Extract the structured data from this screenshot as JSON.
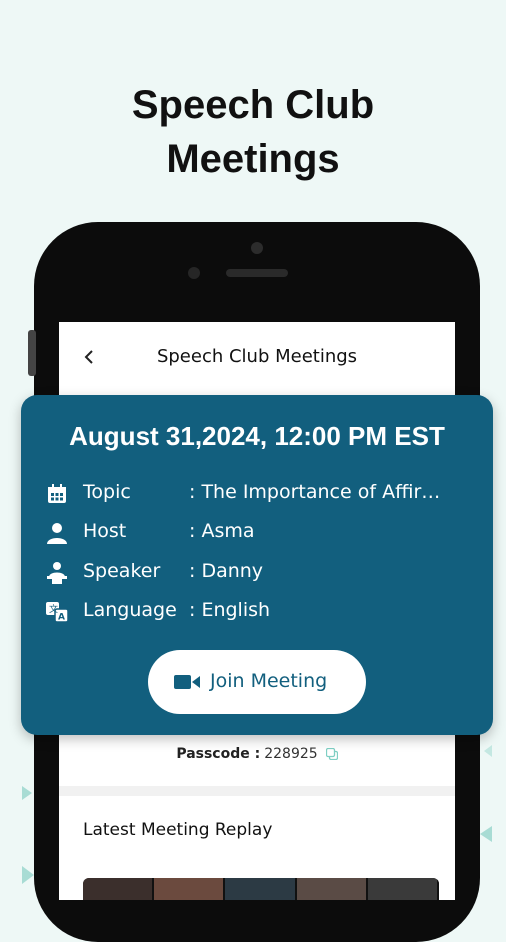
{
  "headline": {
    "line1": "Speech Club",
    "line2": "Meetings"
  },
  "app_bar": {
    "title": "Speech Club Meetings",
    "back_icon": "chevron-left-icon"
  },
  "meeting": {
    "datetime": "August 31,2024, 12:00 PM EST",
    "rows": [
      {
        "label": "Topic",
        "value": ": The Importance of Affir…",
        "icon": "calendar-icon"
      },
      {
        "label": "Host",
        "value": ": Asma",
        "icon": "person-icon"
      },
      {
        "label": "Speaker",
        "value": ": Danny",
        "icon": "speaker-person-icon"
      },
      {
        "label": "Language",
        "value": ": English",
        "icon": "translate-icon"
      }
    ],
    "join_label": "Join Meeting"
  },
  "passcode": {
    "label": "Passcode :",
    "value": "228925"
  },
  "replay": {
    "title": "Latest Meeting Replay"
  },
  "colors": {
    "card": "#125f7e",
    "background": "#eef8f6",
    "accent_teal": "#9fd6cf"
  }
}
